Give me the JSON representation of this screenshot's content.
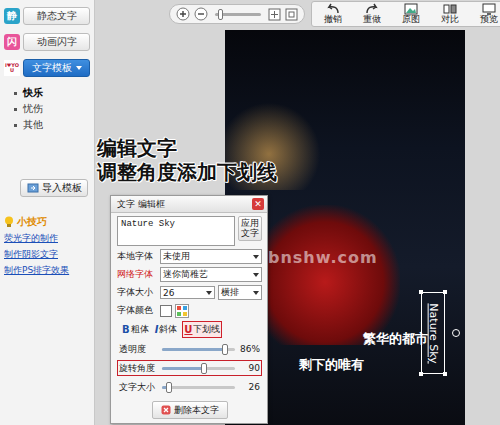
{
  "toolbar": {
    "zoom": {
      "level": 0.1
    },
    "buttons": [
      "撤销",
      "重做",
      "原图",
      "对比",
      "预览"
    ]
  },
  "sidebar": {
    "modes": [
      {
        "label": "静态文字",
        "icon_text": "静",
        "selected": false
      },
      {
        "label": "动画闪字",
        "icon_text": "闪",
        "selected": false
      },
      {
        "label": "文字模板",
        "icon_text": "I♥YOU",
        "selected": true
      }
    ],
    "categories": [
      {
        "label": "快乐",
        "selected": true
      },
      {
        "label": "忧伤",
        "selected": false
      },
      {
        "label": "其他",
        "selected": false
      }
    ],
    "import_button": "导入模板",
    "tips": {
      "title": "小技巧",
      "links": [
        "荧光字的制作",
        "制作阴影文字",
        "制作PS排字效果"
      ]
    }
  },
  "caption": [
    "编辑文字",
    "调整角度添加下划线"
  ],
  "canvas": {
    "layers": [
      {
        "text": "繁华的都市",
        "kind": "horizontal",
        "selected": false
      },
      {
        "text": "剩下的唯有",
        "kind": "horizontal",
        "selected": false
      },
      {
        "text": "Nature Sky",
        "kind": "rotated",
        "selected": true
      }
    ]
  },
  "watermark": "bnshw.com",
  "dialog": {
    "title": "文字 编辑框",
    "close": "✕",
    "text": "Nature Sky",
    "apply": "应用文字",
    "fields": [
      {
        "label": "本地字体",
        "value": "未使用",
        "highlight": false
      },
      {
        "label": "网络字体",
        "value": "迷你简稚艺",
        "highlight": true
      }
    ],
    "size": {
      "label": "字体大小",
      "value": "26",
      "orientation": "横排"
    },
    "color": {
      "label": "字体颜色",
      "color": "#ffffff"
    },
    "styles": [
      {
        "icon": "B",
        "label": "粗体",
        "on": false
      },
      {
        "icon": "I",
        "label": "斜体",
        "on": false
      },
      {
        "icon": "U",
        "label": "下划线",
        "on": true
      }
    ],
    "sliders": [
      {
        "label": "透明度",
        "level": 0.86,
        "reading": "86%",
        "marked": false
      },
      {
        "label": "旋转角度",
        "level": 0.58,
        "reading": "90",
        "marked": true
      },
      {
        "label": "文字大小",
        "level": 0.1,
        "reading": "26",
        "marked": false
      }
    ],
    "delete": "删除本文字"
  }
}
